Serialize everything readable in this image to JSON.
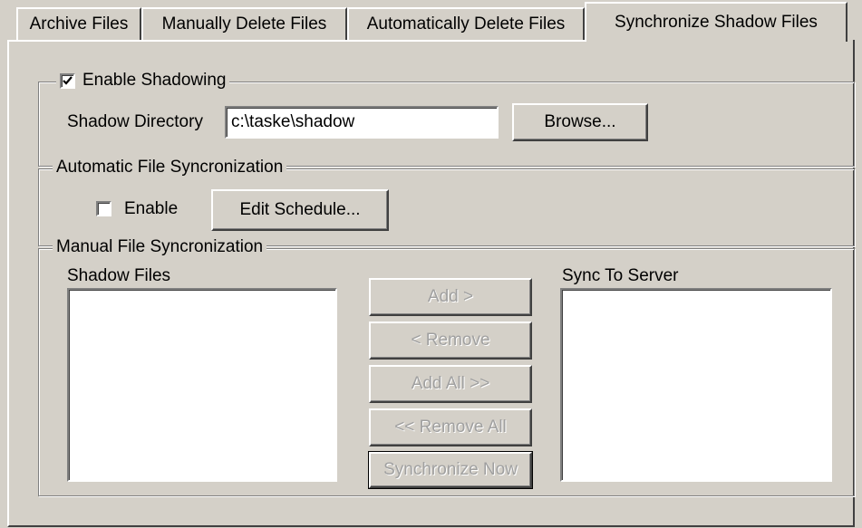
{
  "tabs": [
    {
      "label": "Archive Files"
    },
    {
      "label": "Manually Delete Files"
    },
    {
      "label": "Automatically Delete Files"
    },
    {
      "label": "Synchronize Shadow Files"
    }
  ],
  "shadowing": {
    "enable_label": "Enable Shadowing",
    "enabled": true,
    "directory_label": "Shadow Directory",
    "directory_value": "c:\\taske\\shadow",
    "browse_label": "Browse..."
  },
  "auto_sync": {
    "group_label": "Automatic File Syncronization",
    "enable_label": "Enable",
    "enabled": false,
    "edit_schedule_label": "Edit Schedule..."
  },
  "manual_sync": {
    "group_label": "Manual File Syncronization",
    "shadow_files_label": "Shadow Files",
    "sync_to_server_label": "Sync To Server",
    "shadow_files": [],
    "sync_to_server": [],
    "add_label": "Add >",
    "remove_label": "< Remove",
    "add_all_label": "Add All >>",
    "remove_all_label": "<< Remove All",
    "synchronize_now_label": "Synchronize Now"
  },
  "icons": {
    "checkmark": "checkmark-icon"
  }
}
